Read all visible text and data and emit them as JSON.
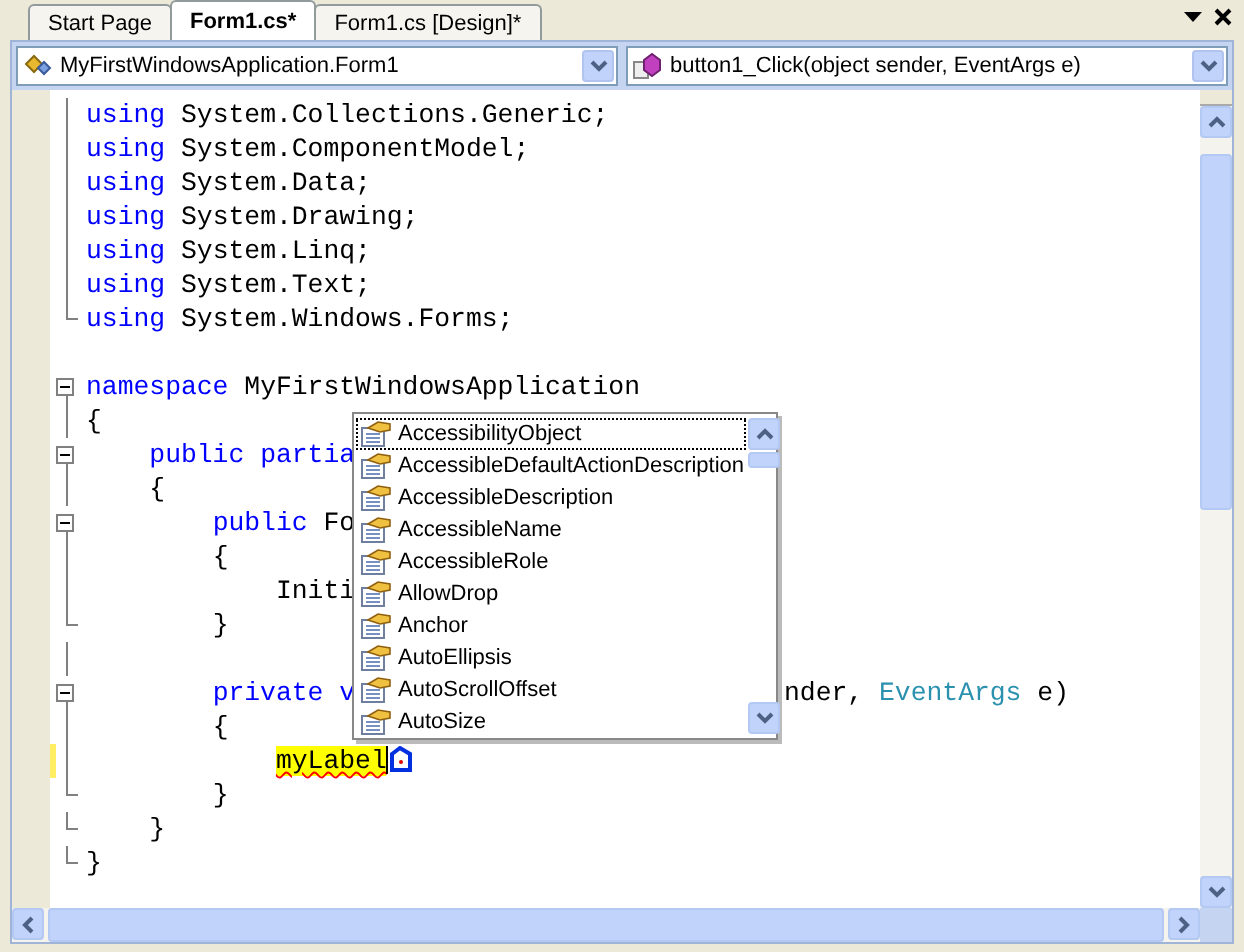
{
  "tabs": [
    {
      "label": "Start Page",
      "selected": false
    },
    {
      "label": "Form1.cs*",
      "selected": true
    },
    {
      "label": "Form1.cs [Design]*",
      "selected": false
    }
  ],
  "type_dropdown": {
    "value": "MyFirstWindowsApplication.Form1"
  },
  "member_dropdown": {
    "value": "button1_Click(object sender, EventArgs e)"
  },
  "code_lines": [
    {
      "kind": "fold-line",
      "tokens": [
        {
          "kind": "keyword",
          "text": "using"
        },
        {
          "kind": "plain",
          "text": " System.Collections.Generic;"
        }
      ]
    },
    {
      "kind": "fold-line",
      "tokens": [
        {
          "kind": "keyword",
          "text": "using"
        },
        {
          "kind": "plain",
          "text": " System.ComponentModel;"
        }
      ]
    },
    {
      "kind": "fold-line",
      "tokens": [
        {
          "kind": "keyword",
          "text": "using"
        },
        {
          "kind": "plain",
          "text": " System.Data;"
        }
      ]
    },
    {
      "kind": "fold-line",
      "tokens": [
        {
          "kind": "keyword",
          "text": "using"
        },
        {
          "kind": "plain",
          "text": " System.Drawing;"
        }
      ]
    },
    {
      "kind": "fold-line",
      "tokens": [
        {
          "kind": "keyword",
          "text": "using"
        },
        {
          "kind": "plain",
          "text": " System.Linq;"
        }
      ]
    },
    {
      "kind": "fold-line",
      "tokens": [
        {
          "kind": "keyword",
          "text": "using"
        },
        {
          "kind": "plain",
          "text": " System.Text;"
        }
      ]
    },
    {
      "kind": "fold-end",
      "tokens": [
        {
          "kind": "keyword",
          "text": "using"
        },
        {
          "kind": "plain",
          "text": " System.Windows.Forms;"
        }
      ]
    },
    {
      "kind": "plain"
    },
    {
      "kind": "fold-start",
      "tokens": [
        {
          "kind": "keyword",
          "text": "namespace"
        },
        {
          "kind": "plain",
          "text": " MyFirstWindowsApplication"
        }
      ]
    },
    {
      "kind": "fold-line",
      "tokens": [
        {
          "kind": "plain",
          "text": "{"
        }
      ]
    },
    {
      "kind": "fold-start",
      "tokens": [
        {
          "kind": "keyword",
          "text": "    public"
        },
        {
          "kind": "keyword",
          "text": " partia"
        }
      ]
    },
    {
      "kind": "fold-line",
      "tokens": [
        {
          "kind": "plain",
          "text": "    {"
        }
      ]
    },
    {
      "kind": "fold-start",
      "tokens": [
        {
          "kind": "keyword",
          "text": "        public"
        },
        {
          "kind": "plain",
          "text": " Fo"
        }
      ]
    },
    {
      "kind": "fold-line",
      "tokens": [
        {
          "kind": "plain",
          "text": "        {"
        }
      ]
    },
    {
      "kind": "fold-line",
      "tokens": [
        {
          "kind": "plain",
          "text": "            Initi"
        }
      ]
    },
    {
      "kind": "fold-end",
      "tokens": [
        {
          "kind": "plain",
          "text": "        }"
        }
      ]
    },
    {
      "kind": "fold-line"
    },
    {
      "kind": "fold-start",
      "tokens": [
        {
          "kind": "keyword",
          "text": "        private"
        },
        {
          "kind": "keyword",
          "text": " v"
        }
      ],
      "tail": [
        {
          "kind": "plain",
          "text": "nder,"
        },
        {
          "kind": "type",
          "text": " EventArgs"
        },
        {
          "kind": "plain",
          "text": " e)"
        }
      ]
    },
    {
      "kind": "fold-line",
      "tokens": [
        {
          "kind": "plain",
          "text": "        {"
        }
      ]
    },
    {
      "kind": "fold-line",
      "changed": true,
      "smart_tag": true,
      "tokens": [
        {
          "kind": "error",
          "text": "            myLabel"
        }
      ]
    },
    {
      "kind": "fold-end",
      "tokens": [
        {
          "kind": "plain",
          "text": "        }"
        }
      ]
    },
    {
      "kind": "fold-end",
      "tokens": [
        {
          "kind": "plain",
          "text": "    }"
        }
      ]
    },
    {
      "kind": "fold-end",
      "tokens": [
        {
          "kind": "plain",
          "text": "}"
        }
      ]
    }
  ],
  "completion_list": [
    {
      "label": "AccessibilityObject",
      "selected": true
    },
    {
      "label": "AccessibleDefaultActionDescription",
      "selected": false
    },
    {
      "label": "AccessibleDescription",
      "selected": false
    },
    {
      "label": "AccessibleName",
      "selected": false
    },
    {
      "label": "AccessibleRole",
      "selected": false
    },
    {
      "label": "AllowDrop",
      "selected": false
    },
    {
      "label": "Anchor",
      "selected": false
    },
    {
      "label": "AutoEllipsis",
      "selected": false
    },
    {
      "label": "AutoScrollOffset",
      "selected": false
    },
    {
      "label": "AutoSize",
      "selected": false
    }
  ]
}
